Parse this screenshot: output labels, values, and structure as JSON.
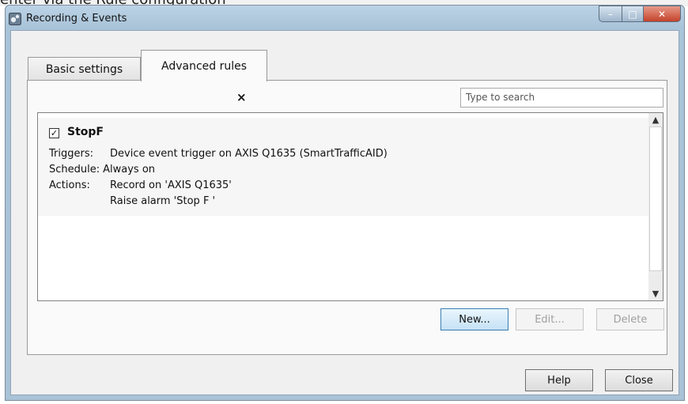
{
  "top_cropped_text": "enter via the Rule configuration",
  "window": {
    "title": "Recording & Events"
  },
  "tabs": [
    {
      "label": "Basic settings",
      "active": false
    },
    {
      "label": "Advanced rules",
      "active": true
    }
  ],
  "search": {
    "placeholder": "Type to search",
    "clear": "×"
  },
  "rule": {
    "checked": true,
    "check_mark": "✓",
    "name": "StopF",
    "triggers_label": "Triggers:",
    "triggers_value": "Device event trigger on AXIS Q1635 (SmartTrafficAID)",
    "schedule_label": "Schedule:",
    "schedule_value": "Always on",
    "actions_label": "Actions:",
    "actions": [
      "Record on 'AXIS Q1635'",
      "Raise alarm 'Stop F '"
    ]
  },
  "rule_buttons": {
    "new": "New...",
    "edit": "Edit...",
    "delete": "Delete"
  },
  "dialog_buttons": {
    "help": "Help",
    "close": "Close"
  },
  "icons": {
    "scroll_up": "▲",
    "scroll_down": "▼",
    "minimize": "–",
    "maximize": "□",
    "close": "✕"
  },
  "colors": {
    "titlebar": "#a9c3d8",
    "primary_button_border": "#3c7fb1",
    "close_button": "#c4432b"
  }
}
